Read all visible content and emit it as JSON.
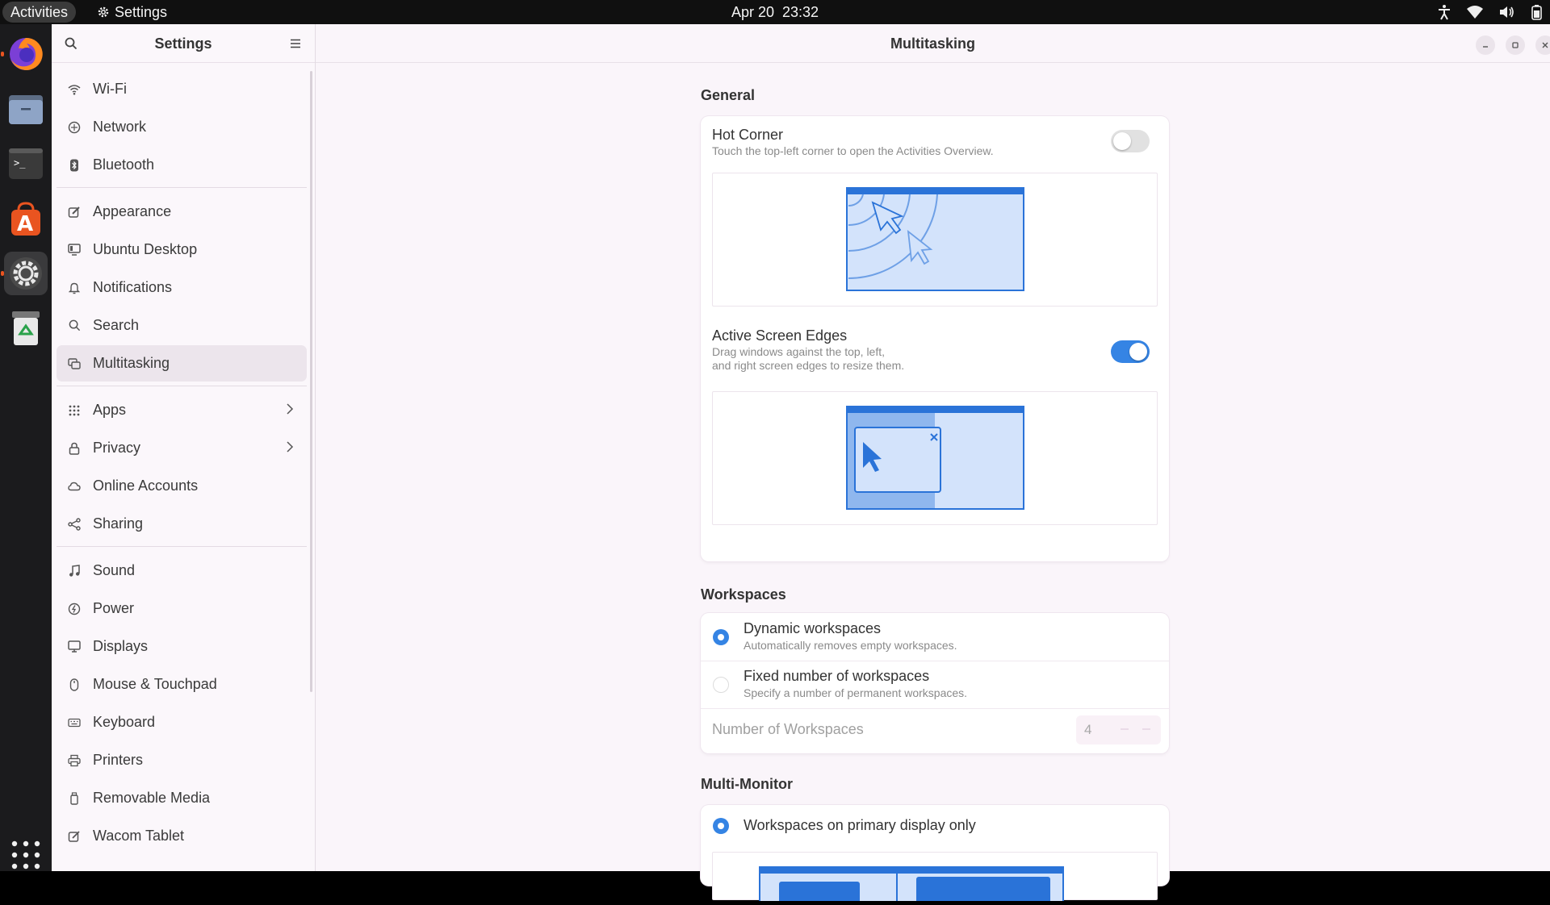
{
  "topbar": {
    "activities": "Activities",
    "app_name": "Settings",
    "date": "Apr 20",
    "time": "23:32"
  },
  "dock": {
    "apps": [
      "Firefox",
      "Files",
      "Terminal",
      "Ubuntu Software",
      "Settings",
      "Trash"
    ]
  },
  "sidebar": {
    "title": "Settings",
    "items": [
      {
        "label": "Wi-Fi",
        "icon": "wifi-icon"
      },
      {
        "label": "Network",
        "icon": "network-icon"
      },
      {
        "label": "Bluetooth",
        "icon": "bluetooth-icon"
      },
      {
        "label": "Appearance",
        "icon": "appearance-icon"
      },
      {
        "label": "Ubuntu Desktop",
        "icon": "ubuntu-desktop-icon"
      },
      {
        "label": "Notifications",
        "icon": "bell-icon"
      },
      {
        "label": "Search",
        "icon": "search-icon"
      },
      {
        "label": "Multitasking",
        "icon": "multitasking-icon"
      },
      {
        "label": "Apps",
        "icon": "apps-icon"
      },
      {
        "label": "Privacy",
        "icon": "lock-icon"
      },
      {
        "label": "Online Accounts",
        "icon": "cloud-icon"
      },
      {
        "label": "Sharing",
        "icon": "share-icon"
      },
      {
        "label": "Sound",
        "icon": "music-note-icon"
      },
      {
        "label": "Power",
        "icon": "power-icon"
      },
      {
        "label": "Displays",
        "icon": "display-icon"
      },
      {
        "label": "Mouse & Touchpad",
        "icon": "mouse-icon"
      },
      {
        "label": "Keyboard",
        "icon": "keyboard-icon"
      },
      {
        "label": "Printers",
        "icon": "printer-icon"
      },
      {
        "label": "Removable Media",
        "icon": "removable-media-icon"
      },
      {
        "label": "Wacom Tablet",
        "icon": "tablet-icon"
      }
    ]
  },
  "content": {
    "title": "Multitasking",
    "general": {
      "heading": "General",
      "hot_corner_title": "Hot Corner",
      "hot_corner_subtitle": "Touch the top-left corner to open the Activities Overview.",
      "hot_corner_enabled": false,
      "edges_title": "Active Screen Edges",
      "edges_subtitle_1": "Drag windows against the top, left,",
      "edges_subtitle_2": "and right screen edges to resize them.",
      "edges_enabled": true
    },
    "workspaces": {
      "heading": "Workspaces",
      "dynamic_title": "Dynamic workspaces",
      "dynamic_subtitle": "Automatically removes empty workspaces.",
      "fixed_title": "Fixed number of workspaces",
      "fixed_subtitle": "Specify a number of permanent workspaces.",
      "number_label": "Number of Workspaces",
      "number_value": "4",
      "selected": "dynamic"
    },
    "multimonitor": {
      "heading": "Multi-Monitor",
      "primary_only": "Workspaces on primary display only"
    }
  },
  "colors": {
    "accent": "#3584e4",
    "ubuntu_orange": "#e95420"
  }
}
